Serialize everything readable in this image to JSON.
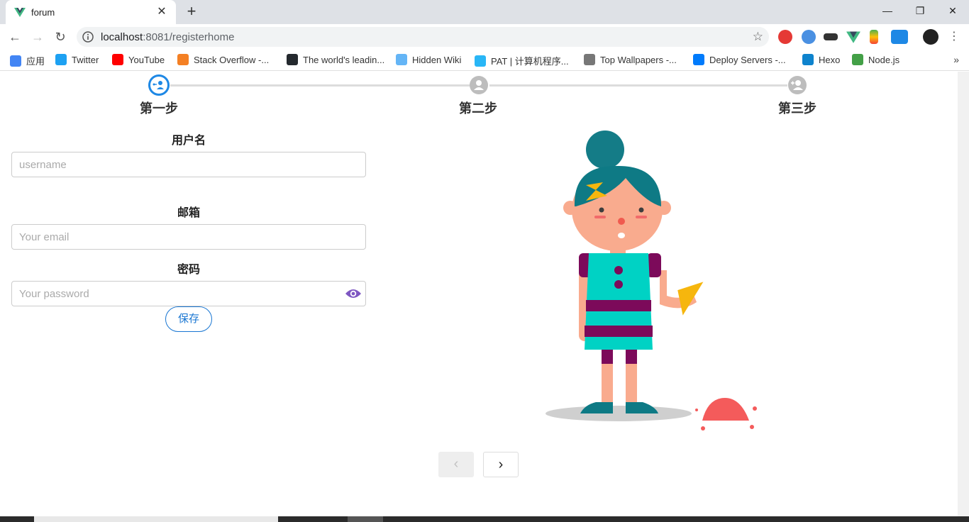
{
  "browser": {
    "tab_title": "forum",
    "url_host": "localhost",
    "url_rest": ":8081/registerhome",
    "bookmarks": [
      {
        "label": "应用",
        "color": "#4285f4"
      },
      {
        "label": "Twitter",
        "color": "#1da1f2"
      },
      {
        "label": "YouTube",
        "color": "#ff0000"
      },
      {
        "label": "Stack Overflow -...",
        "color": "#f48024"
      },
      {
        "label": "The world's leadin...",
        "color": "#24292e"
      },
      {
        "label": "Hidden Wiki",
        "color": "#64b5f6"
      },
      {
        "label": "PAT | 计算机程序...",
        "color": "#29b6f6"
      },
      {
        "label": "Top Wallpapers -...",
        "color": "#777777"
      },
      {
        "label": "Deploy Servers -...",
        "color": "#007bfc"
      },
      {
        "label": "Hexo",
        "color": "#0e83cd"
      },
      {
        "label": "Node.js",
        "color": "#43a047"
      }
    ]
  },
  "steps": [
    {
      "label": "第一步",
      "state": "active",
      "icon": "user-connect-icon"
    },
    {
      "label": "第二步",
      "state": "inactive",
      "icon": "user-icon"
    },
    {
      "label": "第三步",
      "state": "inactive",
      "icon": "user-add-icon"
    }
  ],
  "form": {
    "username_label": "用户名",
    "username_placeholder": "username",
    "email_label": "邮箱",
    "email_placeholder": "Your email",
    "password_label": "密码",
    "password_placeholder": "Your password",
    "save_label": "保存"
  },
  "pagination": {
    "prev": "‹",
    "next": "›"
  },
  "colors": {
    "accent": "#1976d2",
    "eye": "#7e57c2"
  }
}
